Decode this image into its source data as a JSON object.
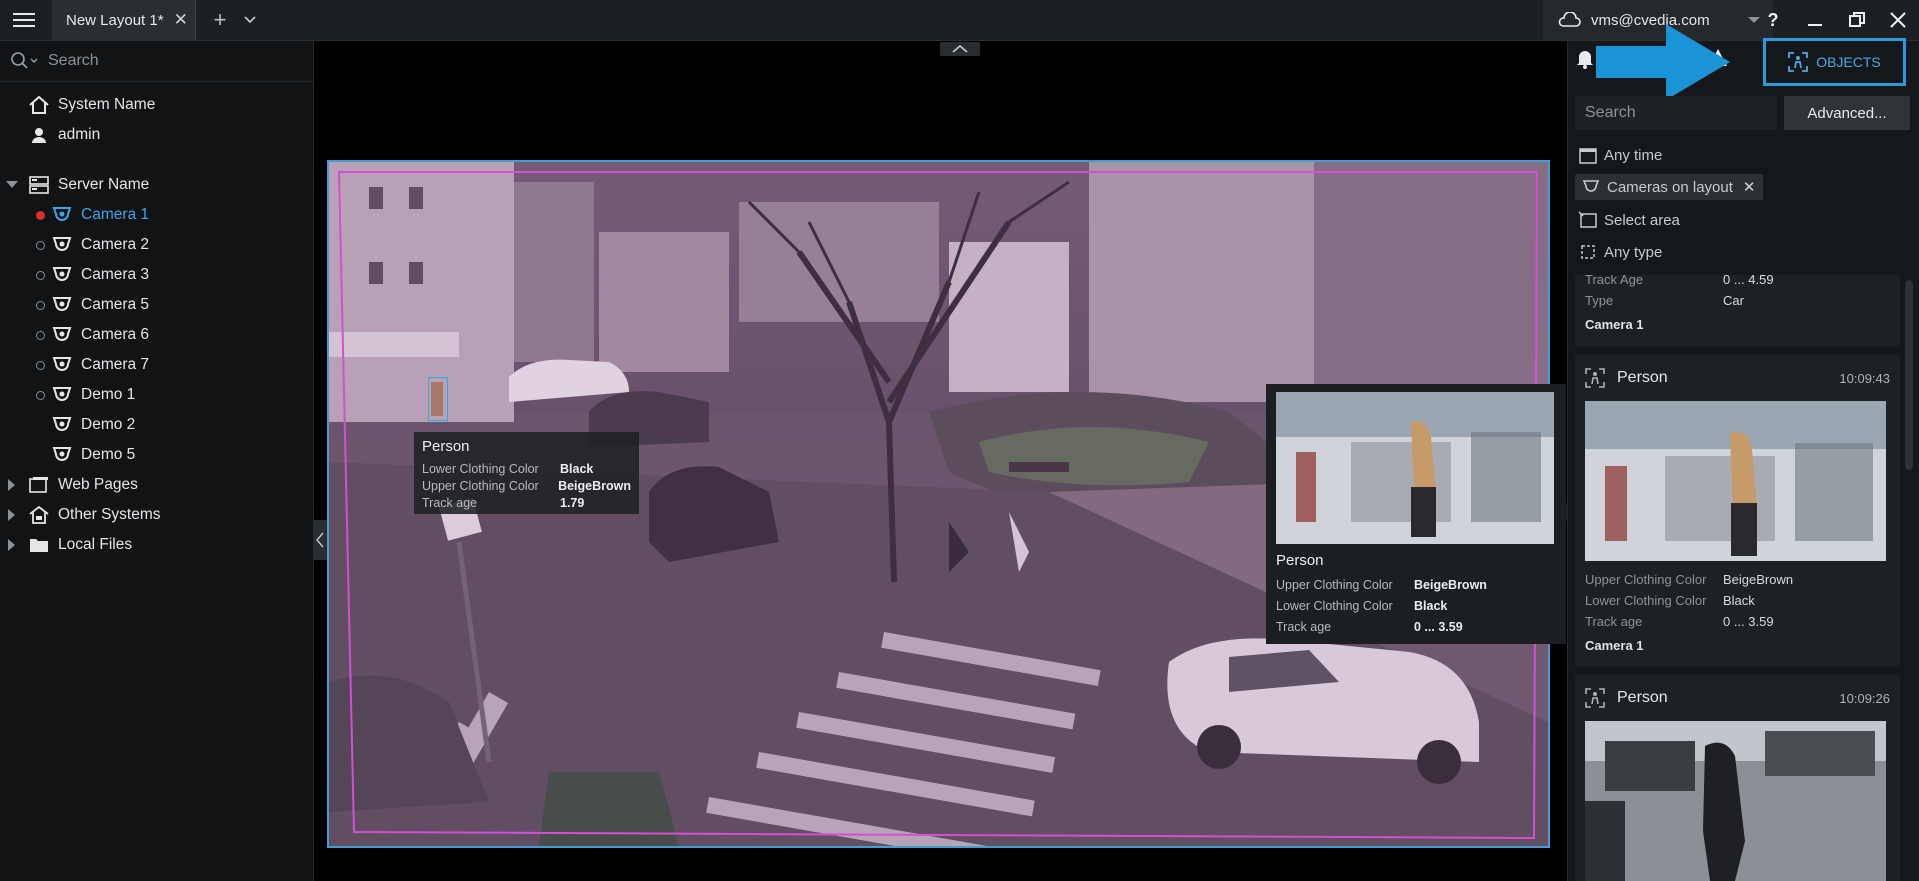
{
  "tabs": [
    {
      "label": "New Layout 1*"
    }
  ],
  "account": {
    "user": "vms@cvedia.com"
  },
  "search": {
    "placeholder": "Search"
  },
  "tree": {
    "system": "System Name",
    "user": "admin",
    "server": "Server Name",
    "cameras": [
      {
        "label": "Camera 1",
        "status": "recording",
        "active": true
      },
      {
        "label": "Camera 2",
        "status": "online"
      },
      {
        "label": "Camera 3",
        "status": "online"
      },
      {
        "label": "Camera 5",
        "status": "online"
      },
      {
        "label": "Camera 6",
        "status": "online"
      },
      {
        "label": "Camera 7",
        "status": "online"
      },
      {
        "label": "Demo 1",
        "status": "online"
      },
      {
        "label": "Demo 2",
        "status": "none"
      },
      {
        "label": "Demo 5",
        "status": "none"
      }
    ],
    "groups": [
      "Web Pages",
      "Other Systems",
      "Local Files"
    ]
  },
  "overlay_person": {
    "title": "Person",
    "rows": [
      {
        "k": "Lower Clothing Color",
        "v": "Black"
      },
      {
        "k": "Upper Clothing Color",
        "v": "BeigeBrown"
      },
      {
        "k": "Track age",
        "v": "1.79"
      }
    ]
  },
  "tooltip": {
    "title": "Person",
    "rows": [
      {
        "k": "Upper Clothing Color",
        "v": "BeigeBrown"
      },
      {
        "k": "Lower Clothing Color",
        "v": "Black"
      },
      {
        "k": "Track age",
        "v": "0 ... 3.59"
      }
    ]
  },
  "right_panel": {
    "objects_label": "OBJECTS",
    "search_placeholder": "Search",
    "advanced_label": "Advanced...",
    "filters": {
      "time": "Any time",
      "cameras": "Cameras on layout",
      "area": "Select area",
      "type": "Any type"
    },
    "partial_card": {
      "rows": [
        {
          "k": "Track Age",
          "v": "0 ... 4.59"
        },
        {
          "k": "Type",
          "v": "Car"
        }
      ],
      "camera": "Camera 1"
    },
    "cards": [
      {
        "name": "Person",
        "time": "10:09:43",
        "rows": [
          {
            "k": "Upper Clothing Color",
            "v": "BeigeBrown"
          },
          {
            "k": "Lower Clothing Color",
            "v": "Black"
          },
          {
            "k": "Track age",
            "v": "0 ... 3.59"
          }
        ],
        "camera": "Camera 1"
      },
      {
        "name": "Person",
        "time": "10:09:26"
      }
    ]
  },
  "colors": {
    "accent": "#2a9bd8",
    "bbox": "#d44fd6",
    "recording": "#d9302c"
  }
}
